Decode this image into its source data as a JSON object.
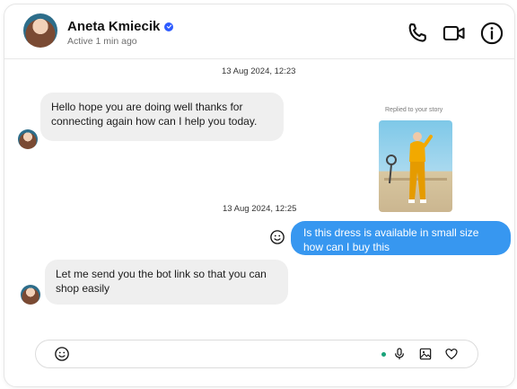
{
  "header": {
    "name": "Aneta Kmiecik",
    "status": "Active 1 min ago"
  },
  "icons": {
    "verified": "verified-badge-icon",
    "call": "phone-icon",
    "video": "video-camera-icon",
    "info": "info-icon",
    "emoji": "smiley-icon",
    "mic": "microphone-icon",
    "image": "image-icon",
    "like": "heart-icon"
  },
  "colors": {
    "outgoing_bubble": "#3797f0",
    "incoming_bubble": "#efefef",
    "verified": "#2d5bff",
    "online_dot": "#1aa37a"
  },
  "conversation": {
    "timestamps": [
      "13 Aug 2024, 12:23",
      "13 Aug 2024, 12:25"
    ],
    "story_reply_label": "Replied to your story",
    "messages": [
      {
        "from": "them",
        "text": "Hello hope you are doing well thanks for connecting again how can I help you today."
      },
      {
        "from": "me",
        "text": "Is this dress is available in small size how can I buy this"
      },
      {
        "from": "them",
        "text": "Let me send you the bot link so that you can shop easily"
      }
    ]
  },
  "composer": {
    "value": "",
    "placeholder": ""
  }
}
